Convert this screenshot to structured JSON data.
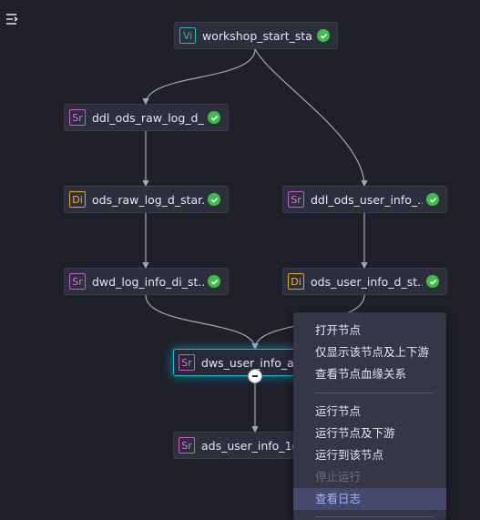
{
  "nodes": [
    {
      "id": "workshop_start",
      "badge": "Vi",
      "type": "vi",
      "label": "workshop_start_sta...",
      "status": "success"
    },
    {
      "id": "ddl_ods_raw",
      "badge": "Sr",
      "type": "sr",
      "label": "ddl_ods_raw_log_d_...",
      "status": "success"
    },
    {
      "id": "ods_raw",
      "badge": "Di",
      "type": "di",
      "label": "ods_raw_log_d_star...",
      "status": "success"
    },
    {
      "id": "ddl_ods_user",
      "badge": "Sr",
      "type": "sr",
      "label": "ddl_ods_user_info_...",
      "status": "success"
    },
    {
      "id": "dwd_log",
      "badge": "Sr",
      "type": "sr",
      "label": "dwd_log_info_di_st...",
      "status": "success"
    },
    {
      "id": "ods_user",
      "badge": "Di",
      "type": "di",
      "label": "ods_user_info_d_st...",
      "status": "success"
    },
    {
      "id": "dws_user",
      "badge": "Sr",
      "type": "sr",
      "label": "dws_user_info_all",
      "status": "",
      "selected": true
    },
    {
      "id": "ads_user",
      "badge": "Sr",
      "type": "sr",
      "label": "ads_user_info_1d",
      "status": ""
    }
  ],
  "context_menu": {
    "items": [
      {
        "label": "打开节点",
        "state": "normal"
      },
      {
        "label": "仅显示该节点及上下游",
        "state": "normal"
      },
      {
        "label": "查看节点血缘关系",
        "state": "normal"
      },
      {
        "separator": true
      },
      {
        "label": "运行节点",
        "state": "normal"
      },
      {
        "label": "运行节点及下游",
        "state": "normal"
      },
      {
        "label": "运行到该节点",
        "state": "normal"
      },
      {
        "label": "停止运行",
        "state": "disabled"
      },
      {
        "label": "查看日志",
        "state": "active"
      },
      {
        "separator": true
      }
    ]
  },
  "colors": {
    "background": "#1f2029",
    "node": "#2d2f3c",
    "edge": "#a4a7b4",
    "success": "#3cbf4a",
    "selected_border": "#18b8d4"
  }
}
